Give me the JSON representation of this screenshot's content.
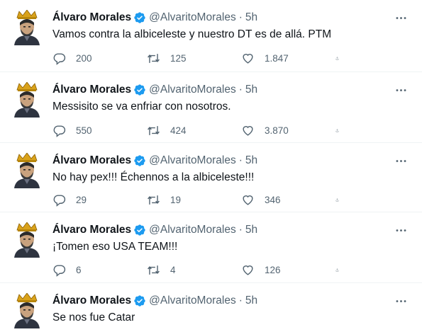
{
  "tweets": [
    {
      "name": "Álvaro Morales",
      "handle": "@AlvaritoMorales",
      "dot": "·",
      "time": "5h",
      "text": "Vamos contra la albiceleste y nuestro DT es de allá. PTM",
      "replies": "200",
      "retweets": "125",
      "likes": "1.847"
    },
    {
      "name": "Álvaro Morales",
      "handle": "@AlvaritoMorales",
      "dot": "·",
      "time": "5h",
      "text": "Messisito se va enfriar con nosotros.",
      "replies": "550",
      "retweets": "424",
      "likes": "3.870"
    },
    {
      "name": "Álvaro Morales",
      "handle": "@AlvaritoMorales",
      "dot": "·",
      "time": "5h",
      "text": "No hay pex!!! Échennos a la albiceleste!!!",
      "replies": "29",
      "retweets": "19",
      "likes": "346"
    },
    {
      "name": "Álvaro Morales",
      "handle": "@AlvaritoMorales",
      "dot": "·",
      "time": "5h",
      "text": "¡Tomen eso USA TEAM!!!",
      "replies": "6",
      "retweets": "4",
      "likes": "126"
    },
    {
      "name": "Álvaro Morales",
      "handle": "@AlvaritoMorales",
      "dot": "·",
      "time": "5h",
      "text": "Se nos fue Catar"
    }
  ],
  "colors": {
    "text": "#0f1419",
    "secondary": "#536471",
    "verified": "#1d9bf0",
    "divider": "#eff3f4"
  },
  "icons": {
    "verified": "verified-badge-icon",
    "more": "more-dots-icon",
    "reply": "reply-icon",
    "retweet": "retweet-icon",
    "like": "heart-icon",
    "share": "share-icon"
  }
}
